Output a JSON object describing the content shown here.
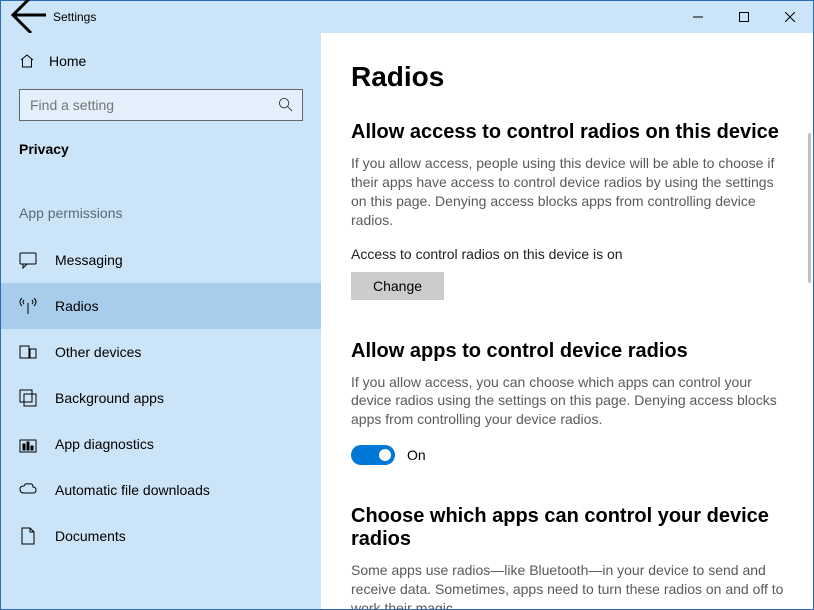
{
  "titlebar": {
    "title": "Settings"
  },
  "home_label": "Home",
  "search": {
    "placeholder": "Find a setting"
  },
  "section": "Privacy",
  "group": "App permissions",
  "nav": {
    "messaging": "Messaging",
    "radios": "Radios",
    "other_devices": "Other devices",
    "background_apps": "Background apps",
    "app_diagnostics": "App diagnostics",
    "automatic_file_downloads": "Automatic file downloads",
    "documents": "Documents"
  },
  "page": {
    "title": "Radios",
    "s1_title": "Allow access to control radios on this device",
    "s1_body": "If you allow access, people using this device will be able to choose if their apps have access to control device radios by using the settings on this page. Denying access blocks apps from controlling device radios.",
    "s1_status": "Access to control radios on this device is on",
    "s1_button": "Change",
    "s2_title": "Allow apps to control device radios",
    "s2_body": "If you allow access, you can choose which apps can control your device radios using the settings on this page. Denying access blocks apps from controlling your device radios.",
    "s2_toggle_label": "On",
    "s3_title": "Choose which apps can control your device radios",
    "s3_body": "Some apps use radios—like Bluetooth—in your device to send and receive data. Sometimes, apps need to turn these radios on and off to work their magic."
  }
}
